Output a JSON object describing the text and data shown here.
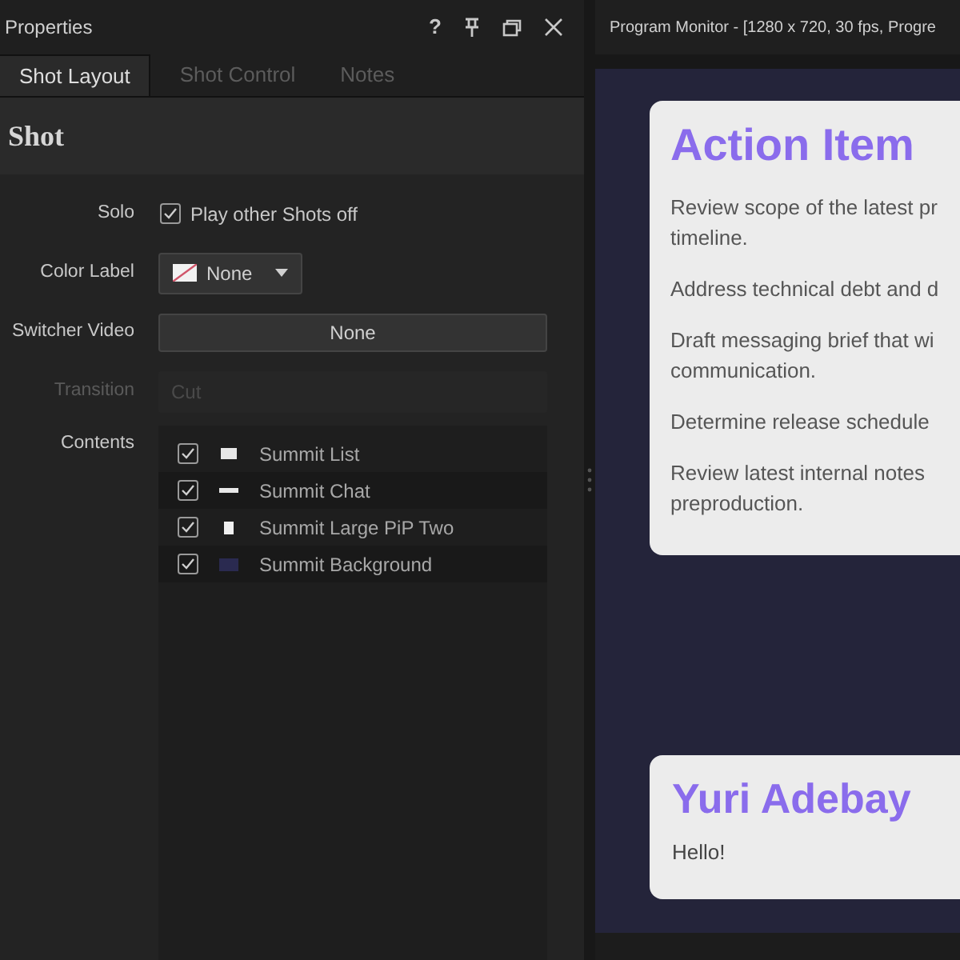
{
  "properties_panel": {
    "title": "Properties",
    "help_glyph": "?",
    "tabs": [
      {
        "label": "Shot Layout",
        "selected": true
      },
      {
        "label": "Shot Control",
        "selected": false
      },
      {
        "label": "Notes",
        "selected": false
      }
    ],
    "section_title": "Shot",
    "fields": [
      {
        "kind": "checkbox",
        "label": "Solo",
        "text": "Play other Shots off",
        "checked": true
      },
      {
        "kind": "dropdown",
        "label": "Color Label",
        "value": "None"
      },
      {
        "kind": "button",
        "label": "Switcher Video",
        "value": "None"
      },
      {
        "kind": "field",
        "label": "Transition",
        "value": "Cut",
        "disabled": true
      }
    ],
    "contents": {
      "label": "Contents",
      "items": [
        {
          "name": "Summit List",
          "checked": true,
          "kind": "list"
        },
        {
          "name": "Summit Chat",
          "checked": true,
          "kind": "chat"
        },
        {
          "name": "Summit Large PiP Two",
          "checked": true,
          "kind": "pip"
        },
        {
          "name": "Summit Background",
          "checked": true,
          "kind": "background"
        }
      ]
    }
  },
  "program_monitor": {
    "title": "Program Monitor - [1280 x 720, 30 fps, Progre",
    "action_card": {
      "title": "Action Item",
      "items": [
        {
          "lines": [
            "Review scope of the latest pr",
            "timeline."
          ]
        },
        {
          "lines": [
            "Address technical debt and d"
          ]
        },
        {
          "lines": [
            "Draft messaging brief that wi",
            "communication."
          ]
        },
        {
          "lines": [
            "Determine release schedule"
          ]
        },
        {
          "lines": [
            "Review latest internal notes",
            "preproduction."
          ]
        }
      ]
    },
    "chat_card": {
      "name": "Yuri Adebay",
      "message": "Hello!"
    }
  }
}
